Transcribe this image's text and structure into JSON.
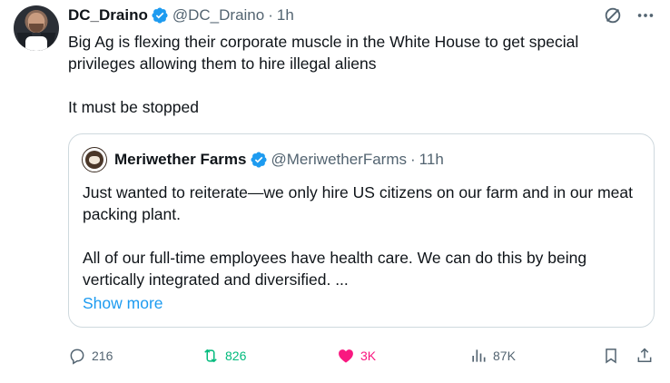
{
  "tweet": {
    "author_name": "DC_Draino",
    "author_handle": "@DC_Draino",
    "separator": "·",
    "time": "1h",
    "paragraphs": [
      "Big Ag is flexing their corporate muscle in the White House to get special privileges allowing them to hire illegal aliens",
      "It must be stopped"
    ]
  },
  "quote": {
    "author_name": "Meriwether Farms",
    "author_handle": "@MeriwetherFarms",
    "separator": "·",
    "time": "11h",
    "paragraphs": [
      "Just wanted to reiterate—we only hire US citizens on our farm and in our meat packing plant.",
      "All of our full-time employees have health care. We can do this by being vertically integrated and diversified. ..."
    ],
    "show_more": "Show more"
  },
  "actions": {
    "replies": "216",
    "retweets": "826",
    "likes": "3K",
    "views": "87K"
  },
  "colors": {
    "verified": "#1d9bf0",
    "link": "#1d9bf0",
    "retweet_active": "#00ba7c",
    "like_active": "#f91880",
    "muted_text": "#536471"
  },
  "icons": {
    "verified": "verified-badge-icon",
    "grok": "grok-icon",
    "more": "more-icon",
    "reply": "reply-icon",
    "retweet": "retweet-icon",
    "like": "heart-icon",
    "views": "views-icon",
    "bookmark": "bookmark-icon",
    "share": "share-icon"
  }
}
